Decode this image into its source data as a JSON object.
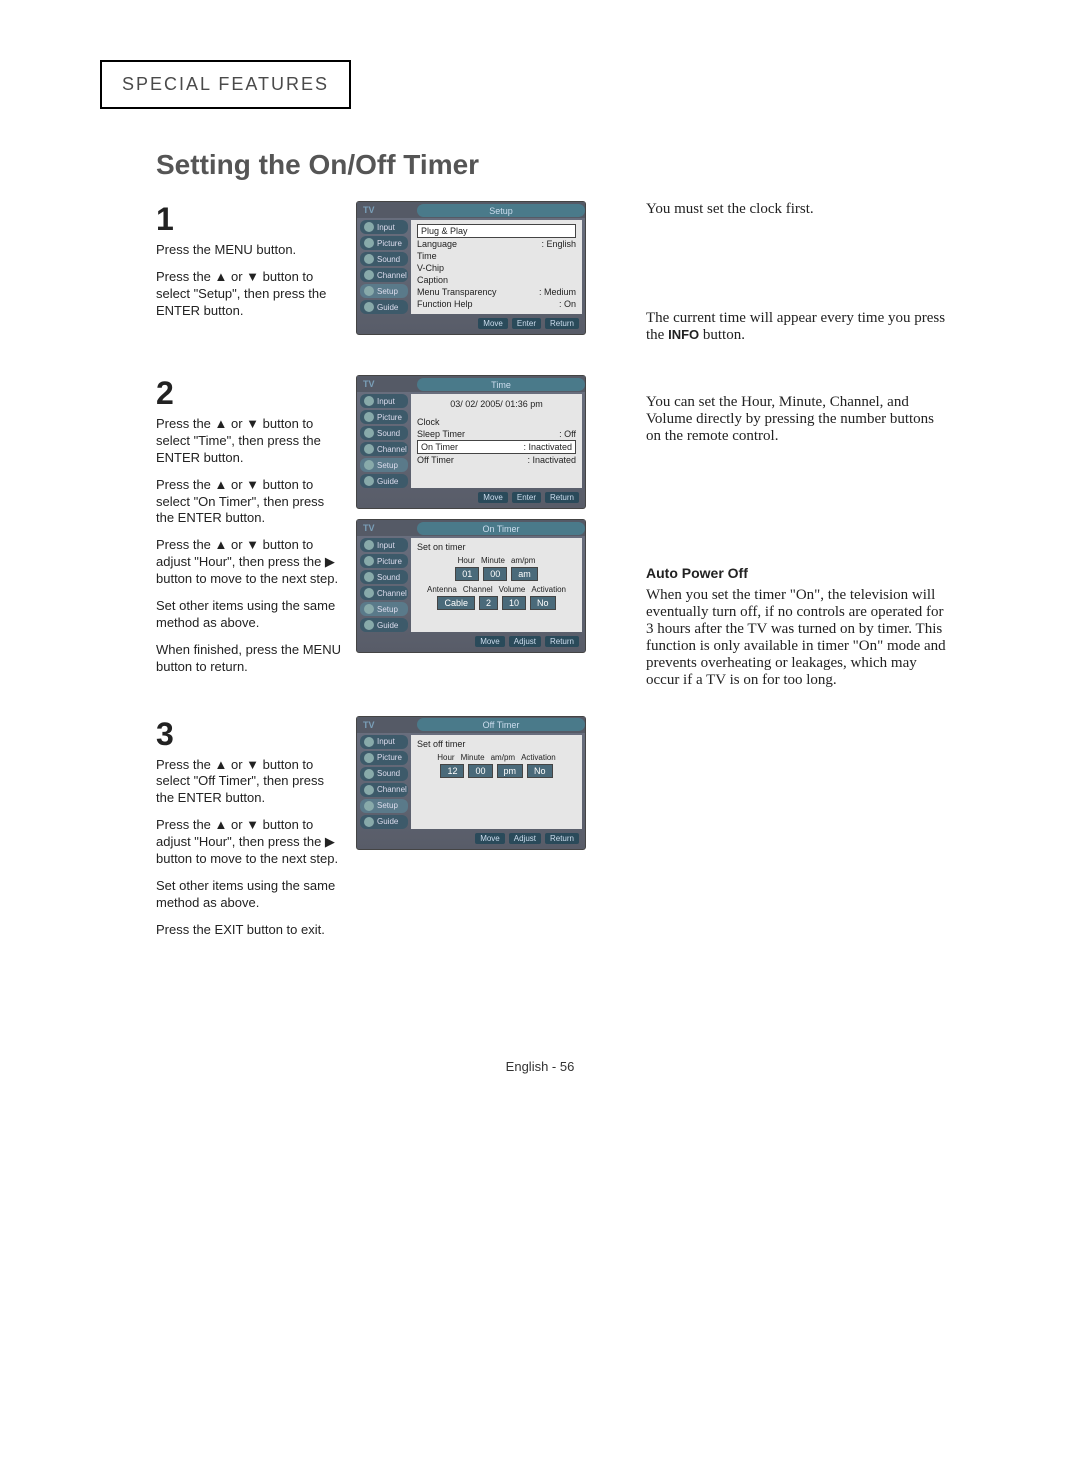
{
  "section_header": "SPECIAL FEATURES",
  "page_title": "Setting the On/Off Timer",
  "step1": {
    "num": "1",
    "p1": "Press the MENU button.",
    "p2": "Press the ▲ or ▼ button to select \"Setup\", then press the ENTER button.",
    "osd": {
      "tv": "TV",
      "title": "Setup",
      "tabs": [
        "Input",
        "Picture",
        "Sound",
        "Channel",
        "Setup",
        "Guide"
      ],
      "rows": [
        {
          "l": "Plug & Play",
          "r": ""
        },
        {
          "l": "Language",
          "r": ": English"
        },
        {
          "l": "Time",
          "r": ""
        },
        {
          "l": "V-Chip",
          "r": ""
        },
        {
          "l": "Caption",
          "r": ""
        },
        {
          "l": "Menu Transparency",
          "r": ": Medium"
        },
        {
          "l": "Function Help",
          "r": ": On"
        }
      ],
      "footer": [
        "Move",
        "Enter",
        "Return"
      ],
      "highlight": 0
    }
  },
  "step2": {
    "num": "2",
    "p1": "Press the ▲ or ▼ button to select \"Time\", then press the ENTER button.",
    "p2": "Press the ▲ or ▼ button to select \"On Timer\", then press the ENTER button.",
    "p3": "Press the ▲ or ▼ button to adjust \"Hour\", then press the ▶ button to move to the next step.",
    "p4": "Set other items using the same method as above.",
    "p5": "When finished, press the MENU button to return.",
    "osd_time": {
      "tv": "TV",
      "title": "Time",
      "tabs": [
        "Input",
        "Picture",
        "Sound",
        "Channel",
        "Setup",
        "Guide"
      ],
      "date": "03/ 02/ 2005/ 01:36 pm",
      "rows": [
        {
          "l": "Clock",
          "r": ""
        },
        {
          "l": "Sleep Timer",
          "r": ": Off"
        },
        {
          "l": "On Timer",
          "r": ": Inactivated"
        },
        {
          "l": "Off Timer",
          "r": ": Inactivated"
        }
      ],
      "footer": [
        "Move",
        "Enter",
        "Return"
      ],
      "highlight": 2
    },
    "osd_on": {
      "tv": "TV",
      "title": "On Timer",
      "tabs": [
        "Input",
        "Picture",
        "Sound",
        "Channel",
        "Setup",
        "Guide"
      ],
      "heading": "Set on timer",
      "row1_labels": [
        "Hour",
        "Minute",
        "am/pm"
      ],
      "row1_vals": [
        "01",
        "00",
        "am"
      ],
      "row2_labels": [
        "Antenna",
        "Channel",
        "Volume",
        "Activation"
      ],
      "row2_vals": [
        "Cable",
        "2",
        "10",
        "No"
      ],
      "footer": [
        "Move",
        "Adjust",
        "Return"
      ]
    }
  },
  "step3": {
    "num": "3",
    "p1": "Press the ▲ or ▼ button to select \"Off Timer\", then press the ENTER button.",
    "p2": "Press the ▲ or ▼ button to adjust \"Hour\", then press the ▶ button to move to the next step.",
    "p3": "Set other items using the same method as above.",
    "p4": "Press the EXIT button to exit.",
    "osd": {
      "tv": "TV",
      "title": "Off Timer",
      "tabs": [
        "Input",
        "Picture",
        "Sound",
        "Channel",
        "Setup",
        "Guide"
      ],
      "heading": "Set off timer",
      "row1_labels": [
        "Hour",
        "Minute",
        "am/pm",
        "Activation"
      ],
      "row1_vals": [
        "12",
        "00",
        "pm",
        "No"
      ],
      "footer": [
        "Move",
        "Adjust",
        "Return"
      ]
    }
  },
  "side": {
    "note1": "You must set the clock first.",
    "note2a": "The current time will appear every time you press the",
    "note2b": "INFO",
    "note2c": "button.",
    "note3": "You can set the Hour, Minute, Channel, and Volume directly by pressing the number buttons on the remote control.",
    "auto_title": "Auto Power Off",
    "auto_body": "When you set the timer \"On\", the television will eventually turn off, if no controls are operated for 3 hours after the TV was turned on by timer. This function is only available in timer \"On\" mode and prevents overheating or leakages, which may occur if a TV is on for too long."
  },
  "page_num": "English - 56"
}
